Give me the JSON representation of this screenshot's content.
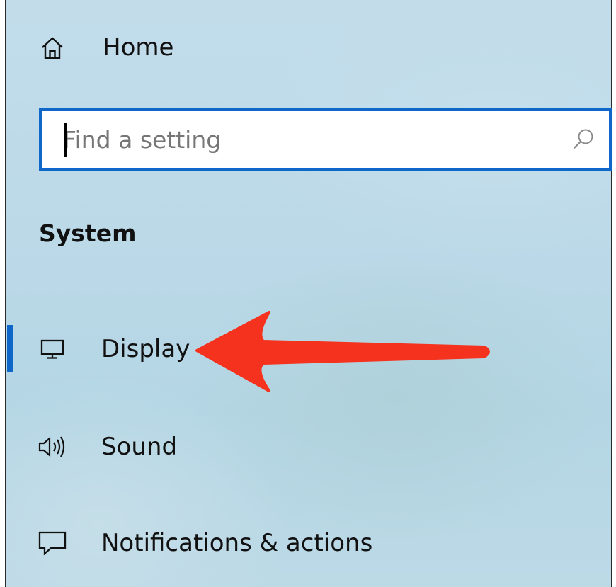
{
  "nav": {
    "home": {
      "label": "Home",
      "icon": "home-icon"
    },
    "search": {
      "placeholder": "Find a setting",
      "value": "",
      "icon": "search-icon"
    },
    "section_title": "System",
    "items": [
      {
        "label": "Display",
        "icon": "display-icon",
        "selected": true
      },
      {
        "label": "Sound",
        "icon": "speaker-icon",
        "selected": false
      },
      {
        "label": "Notifications & actions",
        "icon": "notification-icon",
        "selected": false
      }
    ]
  },
  "colors": {
    "accent": "#0f68c9",
    "annotation_arrow": "#f5321e"
  }
}
